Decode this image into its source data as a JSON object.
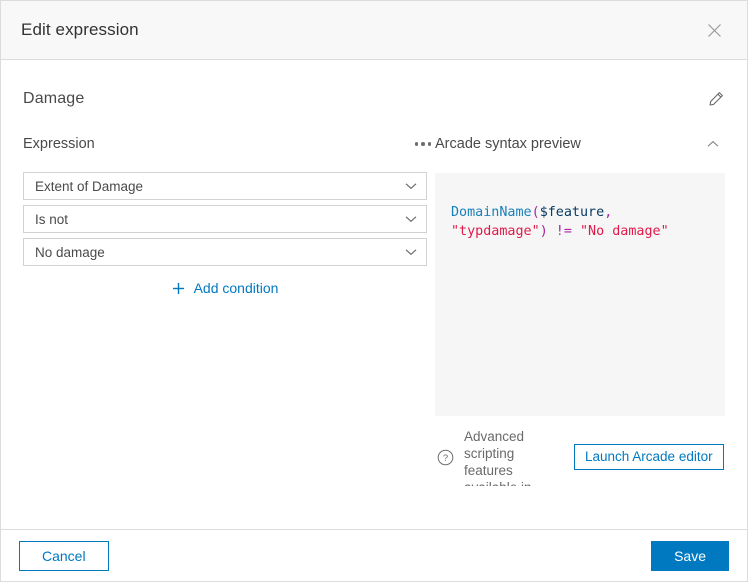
{
  "header": {
    "title": "Edit expression",
    "close_icon": "close-icon"
  },
  "subject": {
    "title": "Damage",
    "edit_icon": "pencil-icon"
  },
  "expression_section": {
    "label": "Expression",
    "overflow_icon": "more-options-icon",
    "conditions": [
      {
        "value": "Extent of Damage",
        "caret_icon": "chevron-down-icon"
      },
      {
        "value": "Is not",
        "caret_icon": "chevron-down-icon"
      },
      {
        "value": "No damage",
        "caret_icon": "chevron-down-icon"
      }
    ],
    "add_condition_label": "Add condition",
    "add_condition_icon": "plus-icon"
  },
  "preview_section": {
    "label": "Arcade syntax preview",
    "collapse_icon": "chevron-up-icon",
    "code_plain": "DomainName($feature, \"typdamage\") != \"No damage\"",
    "code_tokens": [
      {
        "text": "DomainName",
        "type": "fn"
      },
      {
        "text": "(",
        "type": "punct"
      },
      {
        "text": "$feature",
        "type": "var"
      },
      {
        "text": ", ",
        "type": "punct"
      },
      {
        "text": "\"typdamage\"",
        "type": "str"
      },
      {
        "text": ")",
        "type": "punct"
      },
      {
        "text": " != ",
        "type": "op"
      },
      {
        "text": "\"No damage\"",
        "type": "str"
      }
    ],
    "hint_icon": "help-circle-icon",
    "hint_text": "Advanced scripting features available in Arcade editor",
    "launch_button_label": "Launch Arcade editor"
  },
  "footer": {
    "cancel_label": "Cancel",
    "save_label": "Save"
  },
  "colors": {
    "accent": "#0079c1",
    "header_bg": "#f8f8f8",
    "code_bg": "#f6f6f6",
    "border": "#dcdcdc",
    "text": "#4a4a4a",
    "token_function": "#1a80bb",
    "token_variable": "#0a3b66",
    "token_string": "#e01a4a",
    "token_punct": "#a626a4"
  }
}
